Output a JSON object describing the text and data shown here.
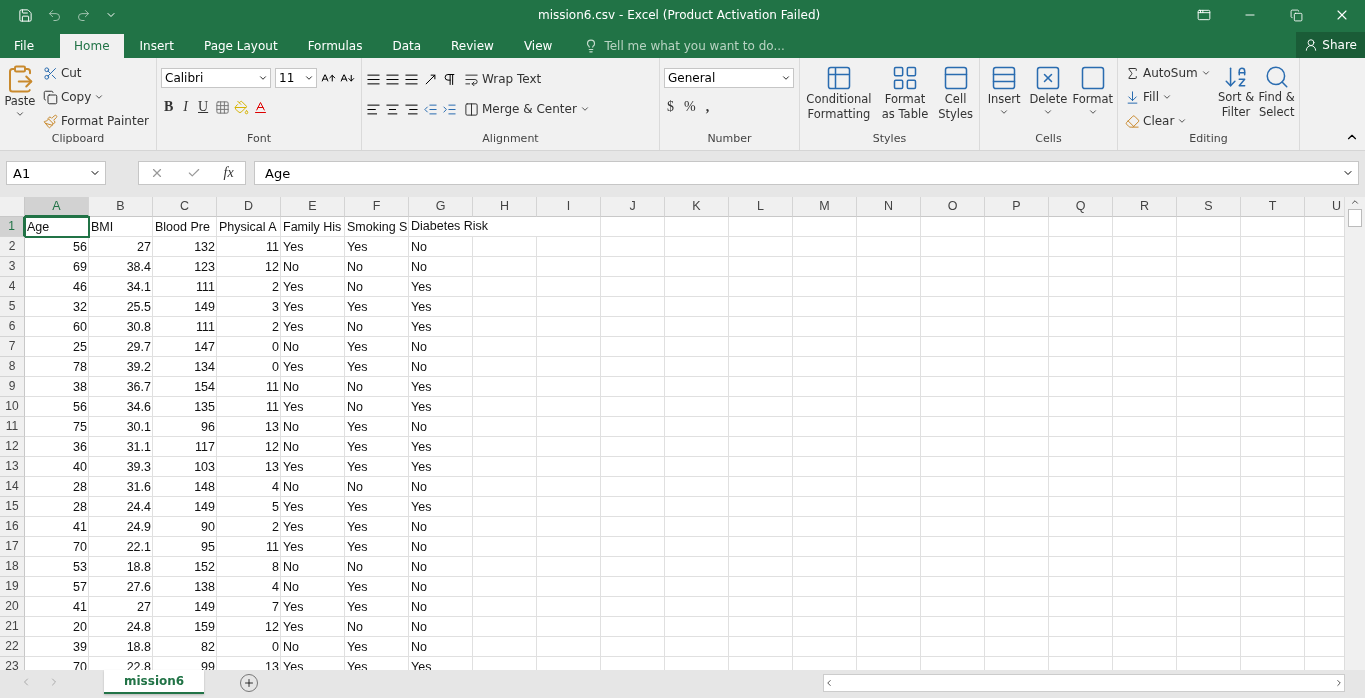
{
  "window": {
    "title": "mission6.csv - Excel (Product Activation Failed)"
  },
  "tabs": [
    {
      "label": "File",
      "selected": false,
      "kind": "file"
    },
    {
      "label": "Home",
      "selected": true,
      "kind": "tab"
    },
    {
      "label": "Insert",
      "selected": false,
      "kind": "tab"
    },
    {
      "label": "Page Layout",
      "selected": false,
      "kind": "tab"
    },
    {
      "label": "Formulas",
      "selected": false,
      "kind": "tab"
    },
    {
      "label": "Data",
      "selected": false,
      "kind": "tab"
    },
    {
      "label": "Review",
      "selected": false,
      "kind": "tab"
    },
    {
      "label": "View",
      "selected": false,
      "kind": "tab"
    }
  ],
  "tell_me": {
    "placeholder": "Tell me what you want to do..."
  },
  "share": "Share",
  "ribbon": {
    "clipboard": {
      "label": "Clipboard",
      "paste": "Paste",
      "cut": "Cut",
      "copy": "Copy",
      "format_painter": "Format Painter"
    },
    "font": {
      "label": "Font",
      "font_name": "Calibri",
      "font_size": "11",
      "bold": "B",
      "italic": "I",
      "underline": "U"
    },
    "alignment": {
      "label": "Alignment",
      "wrap_text": "Wrap Text",
      "merge": "Merge & Center"
    },
    "number": {
      "label": "Number",
      "format": "General",
      "currency": "$",
      "percent": "%",
      "comma": ","
    },
    "styles": {
      "label": "Styles",
      "buttons": [
        "Conditional Formatting",
        "Format as Table",
        "Cell Styles"
      ]
    },
    "cells": {
      "label": "Cells",
      "buttons": [
        "Insert",
        "Delete",
        "Format"
      ]
    },
    "editing": {
      "label": "Editing",
      "autosum": "AutoSum",
      "fill": "Fill",
      "clear": "Clear",
      "buttons": [
        "Sort & Filter",
        "Find & Select"
      ]
    }
  },
  "formula_bar": {
    "name_box": "A1",
    "function_label": "fx",
    "value": "Age"
  },
  "sheet": {
    "columns": [
      {
        "label": "A",
        "kind": "number",
        "selected": true
      },
      {
        "label": "B",
        "kind": "number",
        "selected": false
      },
      {
        "label": "C",
        "kind": "number",
        "selected": false
      },
      {
        "label": "D",
        "kind": "number",
        "selected": false
      },
      {
        "label": "E",
        "kind": "text",
        "selected": false
      },
      {
        "label": "F",
        "kind": "text",
        "selected": false
      },
      {
        "label": "G",
        "kind": "text",
        "selected": false
      },
      {
        "label": "H",
        "selected": false
      },
      {
        "label": "I",
        "selected": false
      },
      {
        "label": "J",
        "selected": false
      },
      {
        "label": "K",
        "selected": false
      },
      {
        "label": "L",
        "selected": false
      },
      {
        "label": "M",
        "selected": false
      },
      {
        "label": "N",
        "selected": false
      },
      {
        "label": "O",
        "selected": false
      },
      {
        "label": "P",
        "selected": false
      },
      {
        "label": "Q",
        "selected": false
      },
      {
        "label": "R",
        "selected": false
      },
      {
        "label": "S",
        "selected": false
      },
      {
        "label": "T",
        "selected": false
      },
      {
        "label": "U",
        "selected": false
      }
    ],
    "header_row": {
      "number": "1",
      "selected": true,
      "cells": [
        {
          "text": "Age",
          "selected": true
        },
        {
          "text": "BMI",
          "selected": false
        },
        {
          "text": "Blood Pre",
          "selected": false
        },
        {
          "text": "Physical A",
          "selected": false
        },
        {
          "text": "Family His",
          "selected": false
        },
        {
          "text": "Smoking S",
          "selected": false
        },
        {
          "text": "Diabetes Risk",
          "selected": false
        }
      ]
    },
    "rows": [
      {
        "number": "2",
        "cells": [
          "56",
          "27",
          "132",
          "11",
          "Yes",
          "Yes",
          "No"
        ]
      },
      {
        "number": "3",
        "cells": [
          "69",
          "38.4",
          "123",
          "12",
          "No",
          "No",
          "No"
        ]
      },
      {
        "number": "4",
        "cells": [
          "46",
          "34.1",
          "111",
          "2",
          "Yes",
          "No",
          "Yes"
        ]
      },
      {
        "number": "5",
        "cells": [
          "32",
          "25.5",
          "149",
          "3",
          "Yes",
          "Yes",
          "Yes"
        ]
      },
      {
        "number": "6",
        "cells": [
          "60",
          "30.8",
          "111",
          "2",
          "Yes",
          "No",
          "Yes"
        ]
      },
      {
        "number": "7",
        "cells": [
          "25",
          "29.7",
          "147",
          "0",
          "No",
          "Yes",
          "No"
        ]
      },
      {
        "number": "8",
        "cells": [
          "78",
          "39.2",
          "134",
          "0",
          "Yes",
          "Yes",
          "No"
        ]
      },
      {
        "number": "9",
        "cells": [
          "38",
          "36.7",
          "154",
          "11",
          "No",
          "No",
          "Yes"
        ]
      },
      {
        "number": "10",
        "cells": [
          "56",
          "34.6",
          "135",
          "11",
          "Yes",
          "No",
          "Yes"
        ]
      },
      {
        "number": "11",
        "cells": [
          "75",
          "30.1",
          "96",
          "13",
          "No",
          "Yes",
          "No"
        ]
      },
      {
        "number": "12",
        "cells": [
          "36",
          "31.1",
          "117",
          "12",
          "No",
          "Yes",
          "Yes"
        ]
      },
      {
        "number": "13",
        "cells": [
          "40",
          "39.3",
          "103",
          "13",
          "Yes",
          "Yes",
          "Yes"
        ]
      },
      {
        "number": "14",
        "cells": [
          "28",
          "31.6",
          "148",
          "4",
          "No",
          "No",
          "No"
        ]
      },
      {
        "number": "15",
        "cells": [
          "28",
          "24.4",
          "149",
          "5",
          "Yes",
          "Yes",
          "Yes"
        ]
      },
      {
        "number": "16",
        "cells": [
          "41",
          "24.9",
          "90",
          "2",
          "Yes",
          "Yes",
          "No"
        ]
      },
      {
        "number": "17",
        "cells": [
          "70",
          "22.1",
          "95",
          "11",
          "Yes",
          "Yes",
          "No"
        ]
      },
      {
        "number": "18",
        "cells": [
          "53",
          "18.8",
          "152",
          "8",
          "No",
          "No",
          "No"
        ]
      },
      {
        "number": "19",
        "cells": [
          "57",
          "27.6",
          "138",
          "4",
          "No",
          "Yes",
          "No"
        ]
      },
      {
        "number": "20",
        "cells": [
          "41",
          "27",
          "149",
          "7",
          "Yes",
          "Yes",
          "No"
        ]
      },
      {
        "number": "21",
        "cells": [
          "20",
          "24.8",
          "159",
          "12",
          "Yes",
          "No",
          "No"
        ]
      },
      {
        "number": "22",
        "cells": [
          "39",
          "18.8",
          "82",
          "0",
          "No",
          "Yes",
          "No"
        ]
      },
      {
        "number": "23",
        "cells": [
          "70",
          "22.8",
          "99",
          "13",
          "Yes",
          "Yes",
          "Yes"
        ]
      }
    ]
  },
  "sheet_tabs": [
    {
      "label": "mission6",
      "selected": true
    }
  ]
}
